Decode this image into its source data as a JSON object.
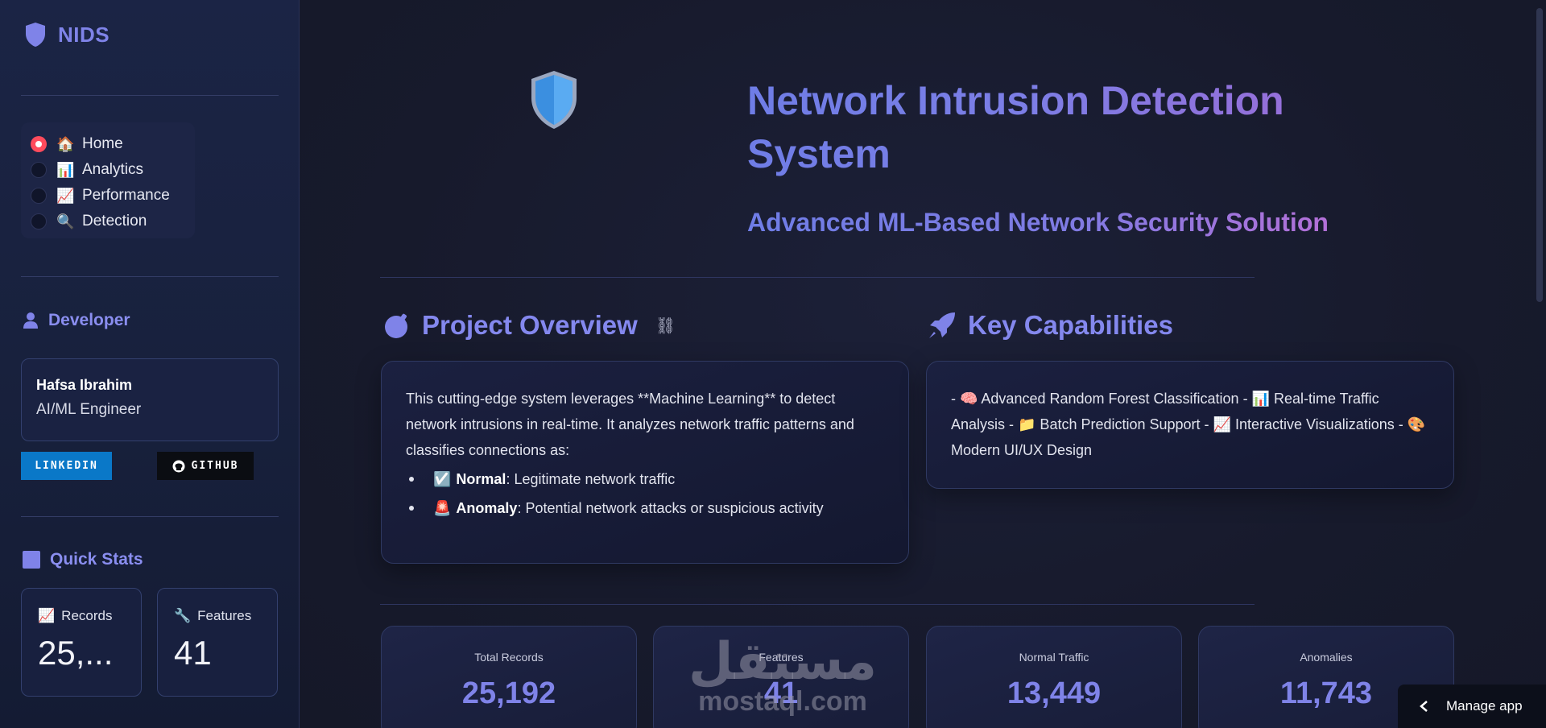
{
  "sidebar": {
    "brand": "NIDS",
    "nav": [
      {
        "emoji": "🏠",
        "label": "Home",
        "selected": true
      },
      {
        "emoji": "📊",
        "label": "Analytics",
        "selected": false
      },
      {
        "emoji": "📈",
        "label": "Performance",
        "selected": false
      },
      {
        "emoji": "🔍",
        "label": "Detection",
        "selected": false
      }
    ],
    "developer": {
      "section_icon": "user-icon",
      "section_title": "Developer",
      "name": "Hafsa Ibrahim",
      "role": "AI/ML Engineer",
      "linkedin_label": "LINKEDIN",
      "github_label": "GITHUB"
    },
    "quick_stats": {
      "section_icon": "square-icon",
      "section_title": "Quick Stats",
      "records_emoji": "📈",
      "records_label": "Records",
      "records_value": "25,...",
      "features_emoji": "🔧",
      "features_label": "Features",
      "features_value": "41"
    }
  },
  "hero": {
    "title": "Network Intrusion Detection System",
    "subtitle": "Advanced ML-Based Network Security Solution"
  },
  "overview": {
    "title": "Project Overview",
    "intro": "This cutting-edge system leverages **Machine Learning** to detect network intrusions in real-time. It analyzes network traffic patterns and classifies connections as:",
    "items": [
      {
        "emoji": "☑️",
        "bold": "Normal",
        "text": ": Legitimate network traffic"
      },
      {
        "emoji": "🚨",
        "bold": "Anomaly",
        "text": ": Potential network attacks or suspicious activity"
      }
    ]
  },
  "capabilities": {
    "title": "Key Capabilities",
    "text": "- 🧠 Advanced Random Forest Classification - 📊 Real-time Traffic Analysis - 📁 Batch Prediction Support - 📈 Interactive Visualizations - 🎨 Modern UI/UX Design"
  },
  "metrics": [
    {
      "label": "Total Records",
      "value": "25,192"
    },
    {
      "label": "Features",
      "value": "41"
    },
    {
      "label": "Normal Traffic",
      "value": "13,449"
    },
    {
      "label": "Anomalies",
      "value": "11,743"
    }
  ],
  "manage_app": "Manage app",
  "watermark": {
    "arabic": "مستقل",
    "latin": "mostaql.com"
  },
  "colors": {
    "accent": "#7f83e8",
    "selected_radio": "#ff4b5c",
    "linkedin": "#0a78c8"
  }
}
